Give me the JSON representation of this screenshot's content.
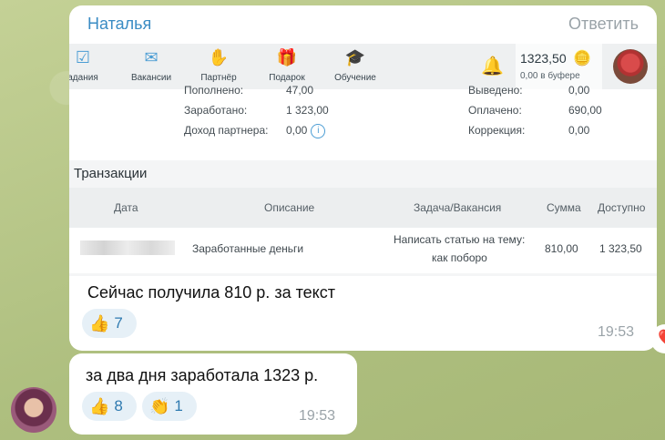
{
  "message1": {
    "sender": "Наталья",
    "reply_label": "Ответить",
    "text": "Сейчас получила 810 р. за текст",
    "reaction": {
      "emoji": "👍",
      "count": "7"
    },
    "time": "19:53"
  },
  "screenshot": {
    "nav": [
      {
        "icon": "tasks-icon",
        "glyph": "☑",
        "label": "адания"
      },
      {
        "icon": "briefcase-icon",
        "glyph": "✉",
        "label": "Вакансии"
      },
      {
        "icon": "handshake-icon",
        "glyph": "✋",
        "label": "Партнёр"
      },
      {
        "icon": "gift-icon",
        "glyph": "🎁",
        "label": "Подарок"
      },
      {
        "icon": "graduation-cap-icon",
        "glyph": "🎓",
        "label": "Обучение"
      }
    ],
    "balance": {
      "amount": "1323,50",
      "buffer": "0,00 в буфере"
    },
    "stats": {
      "left": [
        {
          "label": "Пополнено:",
          "value": "47,00"
        },
        {
          "label": "Заработано:",
          "value": "1 323,00"
        },
        {
          "label": "Доход партнера:",
          "value": "0,00"
        }
      ],
      "right": [
        {
          "label": "Выведено:",
          "value": "0,00"
        },
        {
          "label": "Оплачено:",
          "value": "690,00"
        },
        {
          "label": "Коррекция:",
          "value": "0,00"
        }
      ]
    },
    "transactions_title": "Транзакции",
    "table": {
      "headers": {
        "date": "Дата",
        "description": "Описание",
        "task": "Задача/Вакансия",
        "sum": "Сумма",
        "available": "Доступно"
      },
      "row": {
        "description": "Заработанные деньги",
        "task_line1": "Написать статью на тему:",
        "task_line2": "как поборо",
        "sum": "810,00",
        "available": "1 323,50"
      }
    }
  },
  "message2": {
    "text": "за два дня заработала 1323 р.",
    "reactions": [
      {
        "emoji": "👍",
        "count": "8"
      },
      {
        "emoji": "👏",
        "count": "1"
      }
    ],
    "time": "19:53"
  },
  "side_reaction": {
    "emoji": "❤️"
  },
  "colors": {
    "sender": "#3a8cc4",
    "accent": "#4b9dd4",
    "reaction_bg": "#e6f0f7"
  }
}
